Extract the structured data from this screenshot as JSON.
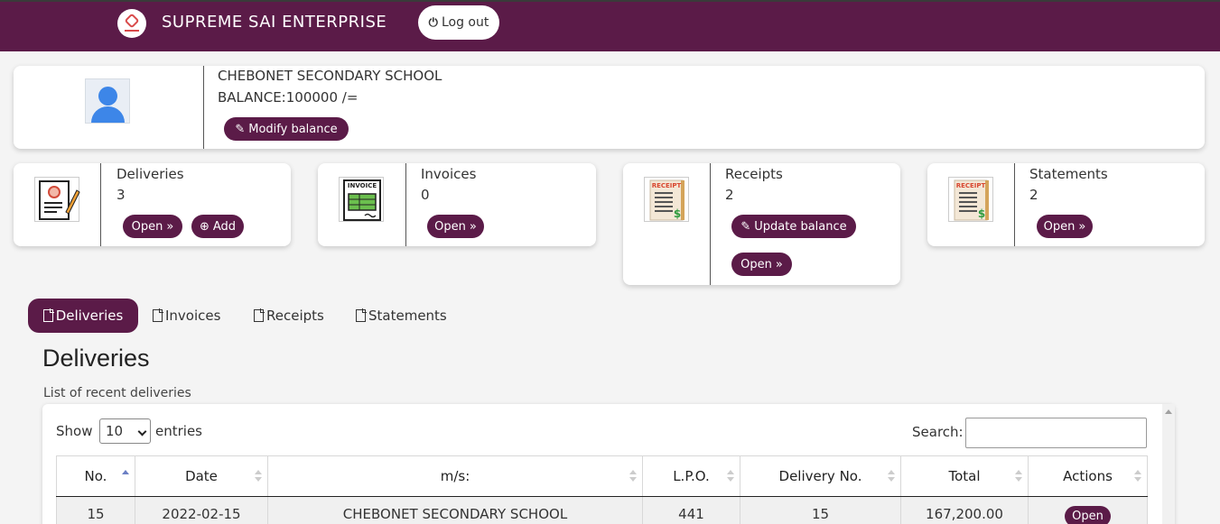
{
  "header": {
    "brand": "SUPREME SAI ENTERPRISE",
    "logout_label": "Log out",
    "logout_icon": "power-icon"
  },
  "profile": {
    "school_name": "CHEBONET SECONDARY SCHOOL",
    "balance": "BALANCE:100000 /=",
    "modify_label": "Modify balance"
  },
  "stats": {
    "deliveries": {
      "title": "Deliveries",
      "count": "3",
      "open_label": "Open",
      "add_label": "Add"
    },
    "invoices": {
      "title": "Invoices",
      "count": "0",
      "open_label": "Open"
    },
    "receipts": {
      "title": "Receipts",
      "count": "2",
      "update_label": "Update balance",
      "open_label": "Open"
    },
    "statements": {
      "title": "Statements",
      "count": "2",
      "open_label": "Open"
    }
  },
  "tabs": [
    "Deliveries",
    "Invoices",
    "Receipts",
    "Statements"
  ],
  "section": {
    "title": "Deliveries",
    "subtitle": "List of recent deliveries"
  },
  "table_controls": {
    "show_label": "Show",
    "page_size": "10",
    "entries_label": "entries",
    "search_label": "Search:"
  },
  "table": {
    "columns": [
      "No.",
      "Date",
      "m/s:",
      "L.P.O.",
      "Delivery No.",
      "Total",
      "Actions"
    ],
    "rows": [
      {
        "no": "15",
        "date": "2022-02-15",
        "ms": "CHEBONET SECONDARY SCHOOL",
        "lpo": "441",
        "delivery_no": "15",
        "total": "167,200.00",
        "action": "Open"
      }
    ]
  },
  "colors": {
    "brand": "#5b1b48"
  }
}
